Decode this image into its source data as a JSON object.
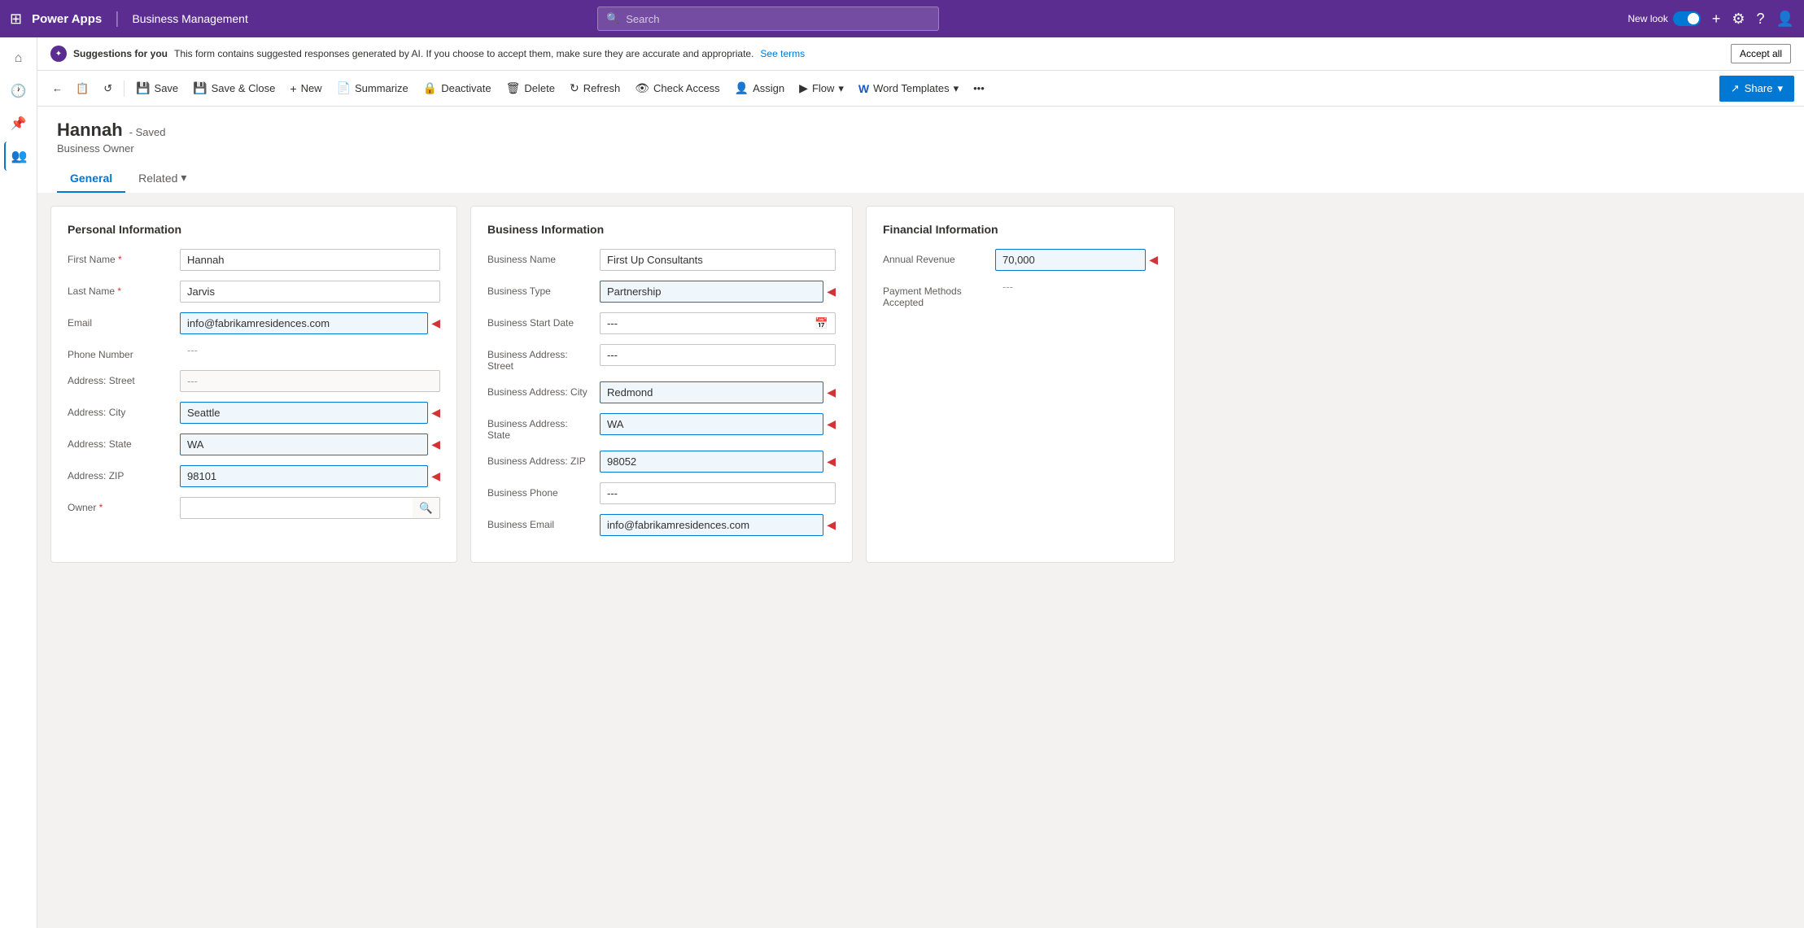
{
  "topNav": {
    "gridIcon": "⊞",
    "logo": "Power Apps",
    "divider": "|",
    "appName": "Business Management",
    "search": {
      "placeholder": "Search",
      "icon": "🔍"
    },
    "newLook": "New look",
    "plusIcon": "+",
    "settingsIcon": "⚙",
    "helpIcon": "?",
    "profileIcon": "👤"
  },
  "suggestionsBanner": {
    "icon": "✦",
    "text": "Suggestions for you",
    "description": "This form contains suggested responses generated by AI. If you choose to accept them, make sure they are accurate and appropriate.",
    "seeTermsLabel": "See terms",
    "acceptAllLabel": "Accept all"
  },
  "commandBar": {
    "backIcon": "←",
    "clipboardIcon": "📋",
    "refreshPageIcon": "↺",
    "saveLabel": "Save",
    "saveIcon": "💾",
    "saveCloseLabel": "Save & Close",
    "saveCloseIcon": "💾",
    "newLabel": "New",
    "newIcon": "+",
    "summarizeLabel": "Summarize",
    "summarizeIcon": "📄",
    "deactivateLabel": "Deactivate",
    "deactivateIcon": "🔒",
    "deleteLabel": "Delete",
    "deleteIcon": "🗑",
    "refreshLabel": "Refresh",
    "refreshIcon": "↻",
    "checkAccessLabel": "Check Access",
    "checkAccessIcon": "👁",
    "assignLabel": "Assign",
    "assignIcon": "👤",
    "flowLabel": "Flow",
    "flowIcon": "▶",
    "flowChevron": "▾",
    "wordTemplatesLabel": "Word Templates",
    "wordTemplatesIcon": "W",
    "wordTemplatesChevron": "▾",
    "moreIcon": "...",
    "shareLabel": "Share",
    "shareIcon": "↗"
  },
  "record": {
    "name": "Hannah",
    "savedStatus": "- Saved",
    "role": "Business Owner",
    "tabs": [
      {
        "label": "General",
        "active": true
      },
      {
        "label": "Related",
        "active": false,
        "chevron": "▾"
      }
    ]
  },
  "personalInfo": {
    "sectionTitle": "Personal Information",
    "fields": {
      "firstName": {
        "label": "First Name",
        "required": true,
        "value": "Hannah",
        "highlighted": false
      },
      "lastName": {
        "label": "Last Name",
        "required": true,
        "value": "Jarvis",
        "highlighted": false
      },
      "email": {
        "label": "Email",
        "value": "info@fabrikamresidences.com",
        "highlighted": true,
        "placeholder": "info@fabrikamresidences.com"
      },
      "phoneNumber": {
        "label": "Phone Number",
        "value": "---"
      },
      "addressStreet": {
        "label": "Address: Street",
        "value": "---"
      },
      "addressCity": {
        "label": "Address: City",
        "value": "Seattle",
        "highlighted": true
      },
      "addressState": {
        "label": "Address: State",
        "value": "WA",
        "highlighted": true
      },
      "addressZip": {
        "label": "Address: ZIP",
        "value": "98101",
        "highlighted": true
      },
      "owner": {
        "label": "Owner",
        "required": true,
        "value": "",
        "placeholder": ""
      }
    }
  },
  "businessInfo": {
    "sectionTitle": "Business Information",
    "fields": {
      "businessName": {
        "label": "Business Name",
        "value": "First Up Consultants"
      },
      "businessType": {
        "label": "Business Type",
        "value": "Partnership",
        "highlighted": true
      },
      "businessStartDate": {
        "label": "Business Start Date",
        "value": "---"
      },
      "businessAddressStreet": {
        "label": "Business Address: Street",
        "value": "---"
      },
      "businessAddressCity": {
        "label": "Business Address: City",
        "value": "Redmond",
        "highlighted": true
      },
      "businessAddressState": {
        "label": "Business Address: State",
        "value": "WA",
        "highlighted": true
      },
      "businessAddressZip": {
        "label": "Business Address: ZIP",
        "value": "98052",
        "highlighted": true
      },
      "businessPhone": {
        "label": "Business Phone",
        "value": "---"
      },
      "businessEmail": {
        "label": "Business Email",
        "value": "info@fabrikamresidences.com",
        "highlighted": true
      }
    }
  },
  "financialInfo": {
    "sectionTitle": "Financial Information",
    "fields": {
      "annualRevenue": {
        "label": "Annual Revenue",
        "value": "70,000",
        "highlighted": true
      },
      "paymentMethodsAccepted": {
        "label": "Payment Methods Accepted",
        "value": "---"
      }
    }
  }
}
